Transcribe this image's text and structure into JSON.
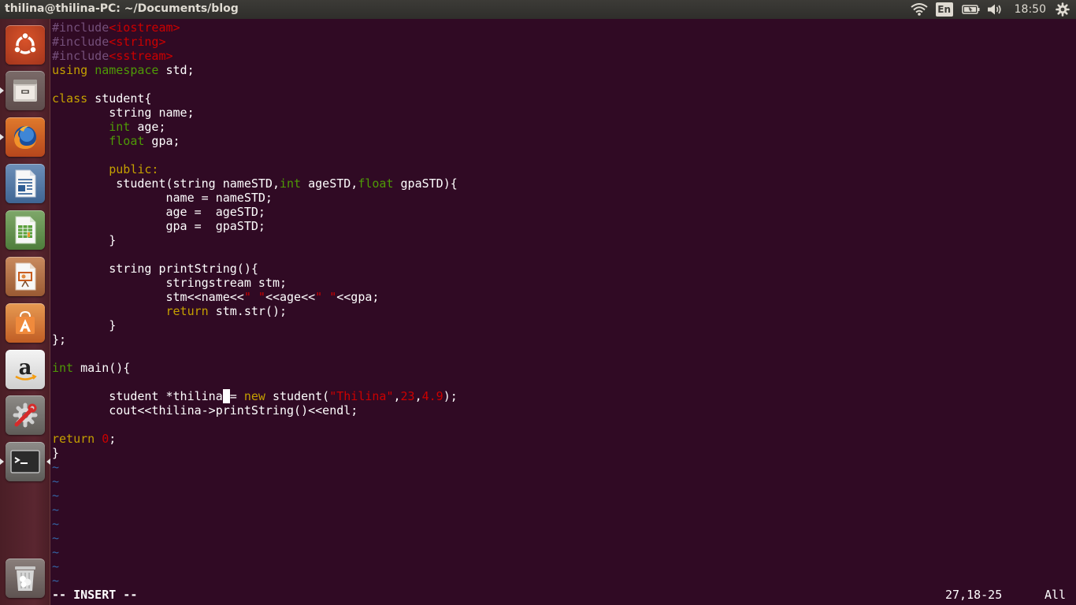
{
  "top_panel": {
    "title": "thilina@thilina-PC: ~/Documents/blog",
    "lang": "En",
    "clock": "18:50",
    "icons": [
      "wifi-icon",
      "keyboard-lang-icon",
      "battery-icon",
      "volume-icon",
      "gear-icon"
    ]
  },
  "launcher": {
    "items": [
      {
        "name": "ubuntu-dash",
        "icon": "ubuntu-logo-icon"
      },
      {
        "name": "files",
        "icon": "files-icon",
        "running": true
      },
      {
        "name": "firefox",
        "icon": "firefox-icon",
        "running": true
      },
      {
        "name": "libreoffice-writer",
        "icon": "writer-icon"
      },
      {
        "name": "libreoffice-calc",
        "icon": "calc-icon"
      },
      {
        "name": "libreoffice-impress",
        "icon": "impress-icon"
      },
      {
        "name": "software-center",
        "icon": "software-center-icon"
      },
      {
        "name": "amazon",
        "icon": "amazon-icon"
      },
      {
        "name": "system-settings",
        "icon": "settings-icon"
      },
      {
        "name": "terminal",
        "icon": "terminal-icon",
        "running": true,
        "active": true
      },
      {
        "name": "trash",
        "icon": "trash-icon"
      }
    ]
  },
  "editor": {
    "lines": [
      [
        [
          "#include",
          "preproc"
        ],
        [
          "<iostream>",
          "string"
        ]
      ],
      [
        [
          "#include",
          "preproc"
        ],
        [
          "<string>",
          "string"
        ]
      ],
      [
        [
          "#include",
          "preproc"
        ],
        [
          "<sstream>",
          "string"
        ]
      ],
      [
        [
          "using",
          "keyword"
        ],
        [
          " ",
          "white"
        ],
        [
          "namespace",
          "type"
        ],
        [
          " std;",
          "white"
        ]
      ],
      [],
      [
        [
          "class",
          "keyword"
        ],
        [
          " student{",
          "white"
        ]
      ],
      [
        [
          "        string name;",
          "white"
        ]
      ],
      [
        [
          "        ",
          "white"
        ],
        [
          "int",
          "type"
        ],
        [
          " age;",
          "white"
        ]
      ],
      [
        [
          "        ",
          "white"
        ],
        [
          "float",
          "type"
        ],
        [
          " gpa;",
          "white"
        ]
      ],
      [],
      [
        [
          "        ",
          "white"
        ],
        [
          "public:",
          "keyword"
        ]
      ],
      [
        [
          "         student(string nameSTD,",
          "white"
        ],
        [
          "int",
          "type"
        ],
        [
          " ageSTD,",
          "white"
        ],
        [
          "float",
          "type"
        ],
        [
          " gpaSTD){",
          "white"
        ]
      ],
      [
        [
          "                name = nameSTD;",
          "white"
        ]
      ],
      [
        [
          "                age =  ageSTD;",
          "white"
        ]
      ],
      [
        [
          "                gpa =  gpaSTD;",
          "white"
        ]
      ],
      [
        [
          "        }",
          "white"
        ]
      ],
      [],
      [
        [
          "        string printString(){",
          "white"
        ]
      ],
      [
        [
          "                stringstream stm;",
          "white"
        ]
      ],
      [
        [
          "                stm<<name<<",
          "white"
        ],
        [
          "\" \"",
          "string"
        ],
        [
          "<<age<<",
          "white"
        ],
        [
          "\" \"",
          "string"
        ],
        [
          "<<gpa;",
          "white"
        ]
      ],
      [
        [
          "                ",
          "white"
        ],
        [
          "return",
          "keyword"
        ],
        [
          " stm.str();",
          "white"
        ]
      ],
      [
        [
          "        }",
          "white"
        ]
      ],
      [
        [
          "};",
          "white"
        ]
      ],
      [],
      [
        [
          "int",
          "type"
        ],
        [
          " main(){",
          "white"
        ]
      ],
      [],
      [
        [
          "        student *thilina",
          "white"
        ],
        [
          " ",
          "cursor"
        ],
        [
          "= ",
          "white"
        ],
        [
          "new",
          "keyword"
        ],
        [
          " student(",
          "white"
        ],
        [
          "\"Thilina\"",
          "string"
        ],
        [
          ",",
          "white"
        ],
        [
          "23",
          "number"
        ],
        [
          ",",
          "white"
        ],
        [
          "4.9",
          "number"
        ],
        [
          ");",
          "white"
        ]
      ],
      [
        [
          "        cout<<thilina->printString()<<endl;",
          "white"
        ]
      ],
      [],
      [
        [
          "return",
          "keyword"
        ],
        [
          " ",
          "white"
        ],
        [
          "0",
          "number"
        ],
        [
          ";",
          "white"
        ]
      ],
      [
        [
          "}",
          "white"
        ]
      ],
      [
        [
          "~",
          "tilde"
        ]
      ],
      [
        [
          "~",
          "tilde"
        ]
      ],
      [
        [
          "~",
          "tilde"
        ]
      ],
      [
        [
          "~",
          "tilde"
        ]
      ],
      [
        [
          "~",
          "tilde"
        ]
      ],
      [
        [
          "~",
          "tilde"
        ]
      ],
      [
        [
          "~",
          "tilde"
        ]
      ],
      [
        [
          "~",
          "tilde"
        ]
      ],
      [
        [
          "~",
          "tilde"
        ]
      ]
    ],
    "status": {
      "mode": "-- INSERT --",
      "position": "27,18-25",
      "scroll": "All"
    }
  }
}
